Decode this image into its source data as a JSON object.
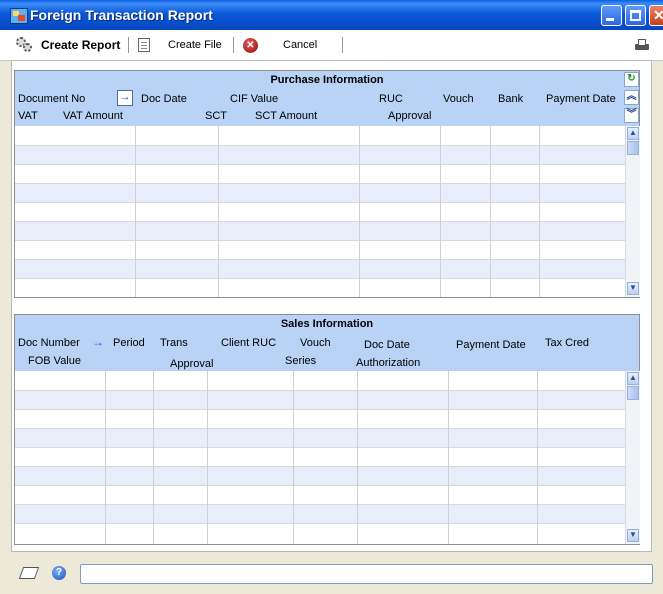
{
  "window": {
    "title": "Foreign Transaction Report"
  },
  "toolbar": {
    "create_report": "Create Report",
    "create_file": "Create File",
    "cancel": "Cancel"
  },
  "purchase": {
    "title": "Purchase Information",
    "row1": {
      "document_no": "Document No",
      "doc_date": "Doc Date",
      "cif_value": "CIF Value",
      "ruc": "RUC",
      "vouch": "Vouch",
      "bank": "Bank",
      "payment_date": "Payment Date"
    },
    "row2": {
      "vat": "VAT",
      "vat_amount": "VAT Amount",
      "sct": "SCT",
      "sct_amount": "SCT Amount",
      "approval": "Approval"
    }
  },
  "sales": {
    "title": "Sales Information",
    "row1": {
      "doc_number": "Doc Number",
      "period": "Period",
      "trans": "Trans",
      "client_ruc": "Client RUC",
      "vouch": "Vouch",
      "doc_date": "Doc Date",
      "payment_date": "Payment Date",
      "tax_cred": "Tax Cred"
    },
    "row2": {
      "fob_value": "FOB Value",
      "approval": "Approval",
      "series": "Series",
      "authorization": "Authorization"
    }
  },
  "colors": {
    "header_bg": "#b8d3f5",
    "row_band": "#e7eefa",
    "title_bar": "#0a58d8"
  },
  "icons": {
    "app": "app-icon",
    "create_report": "gears-icon",
    "create_file": "document-icon",
    "cancel": "cancel-icon",
    "print": "printer-icon",
    "note": "note-icon",
    "help": "help-icon"
  }
}
